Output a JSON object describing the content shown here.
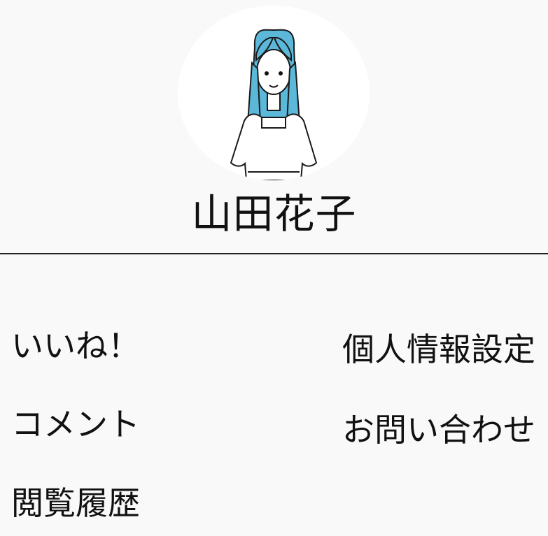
{
  "profile": {
    "name": "山田花子",
    "avatar_icon": "woman-avatar-icon",
    "avatar_hair_color": "#5bb8d9"
  },
  "menu": {
    "left": [
      {
        "label": "いいね！"
      },
      {
        "label": "コメント"
      },
      {
        "label": "閲覧履歴"
      }
    ],
    "right": [
      {
        "label": "個人情報設定"
      },
      {
        "label": "お問い合わせ"
      }
    ]
  }
}
